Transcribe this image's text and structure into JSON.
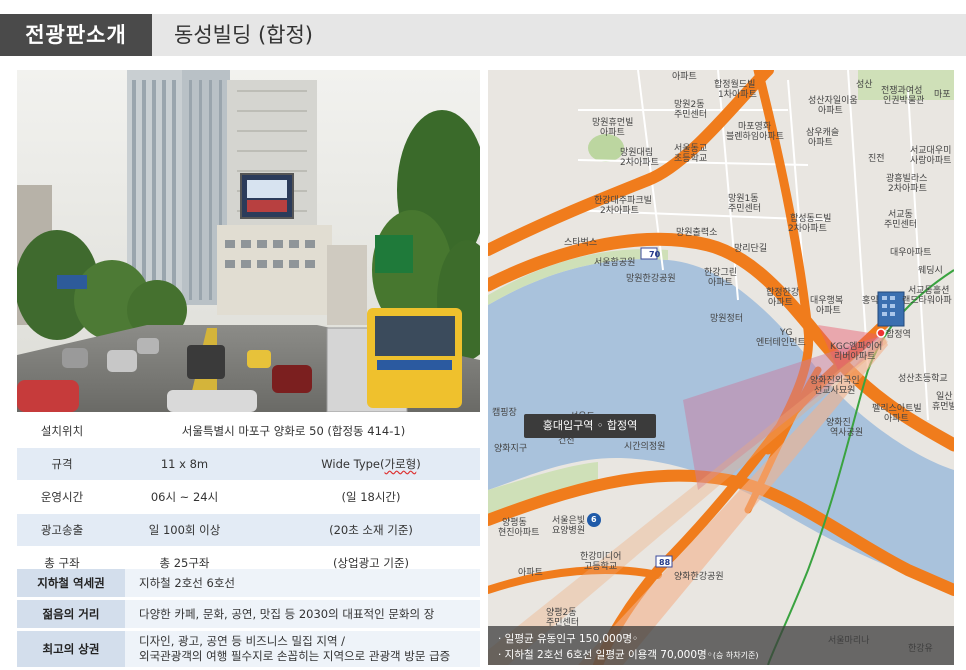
{
  "header": {
    "tag": "전광판소개",
    "title": "동성빌딩 (합정)"
  },
  "specs": [
    {
      "label": "설치위치",
      "value": "서울특별시  마포구 양화로 50 (합정동 414-1)"
    },
    {
      "label": "규격",
      "value": "11 x 8m",
      "extra_pre": "Wide Type(",
      "extra_mark": "가로형",
      "extra_post": ")"
    },
    {
      "label": "운영시간",
      "value": "06시 ~ 24시",
      "extra": "(일 18시간)"
    },
    {
      "label": "광고송출",
      "value": "일 100회 이상",
      "extra": "(20초 소재 기준)"
    },
    {
      "label": "총 구좌",
      "value": "총 25구좌",
      "extra": "(상업광고  기준)"
    }
  ],
  "features": [
    {
      "label": "지하철 역세권",
      "lines": [
        "지하철 2호선 6호선"
      ]
    },
    {
      "label": "젊음의 거리",
      "lines": [
        "다양한 카페, 문화, 공연, 맛집 등 2030의 대표적인 문화의 장"
      ]
    },
    {
      "label": "최고의 상권",
      "lines": [
        "디자인, 광고, 공연 등 비즈니스 밀집 지역 /",
        "외국관광객의  여행 필수지로 손꼽히는 지역으로 관광객 방문 급증"
      ]
    }
  ],
  "map": {
    "station_label": "홍대입구역 ◦ 합정역",
    "foot_line1": "· 일평균 유동인구 150,000명◦",
    "foot_line2_main": "· 지하철 2호선 6호선 일평균 이용객 70,000명◦",
    "foot_line2_small": "(승 하차기준)",
    "route_badges": [
      "70",
      "6",
      "88"
    ],
    "labels": [
      {
        "id": "apt1",
        "text": "아파트"
      },
      {
        "id": "hapjeong1",
        "text": "합정월드빌"
      },
      {
        "id": "hapjeong1b",
        "text": "1차아파트"
      },
      {
        "id": "seongsan",
        "text": "성산"
      },
      {
        "id": "jeonjeol",
        "text": "전쟁과여성"
      },
      {
        "id": "jeonjeolb",
        "text": "인권박물관"
      },
      {
        "id": "mangwon2",
        "text": "망원2동"
      },
      {
        "id": "mangwon2b",
        "text": "주민센터"
      },
      {
        "id": "seongsan2",
        "text": "성산자일이움"
      },
      {
        "id": "seongsan2b",
        "text": "아파트"
      },
      {
        "id": "mapo_r",
        "text": "마포"
      },
      {
        "id": "mangwonapt",
        "text": "망원휴먼빌"
      },
      {
        "id": "mangwonaptb",
        "text": "아파트"
      },
      {
        "id": "mapoyounghwa",
        "text": "마포영화"
      },
      {
        "id": "mapoyounghwab",
        "text": "블렌하임아파트"
      },
      {
        "id": "mangwondaerim",
        "text": "망원대림"
      },
      {
        "id": "mangwondaerimb",
        "text": "2차아파트"
      },
      {
        "id": "seoulelem",
        "text": "서울동교"
      },
      {
        "id": "seoulelemb",
        "text": "초등학교"
      },
      {
        "id": "samwoo",
        "text": "삼우캐슬"
      },
      {
        "id": "samwoob",
        "text": "아파트"
      },
      {
        "id": "jinjeon",
        "text": "진전"
      },
      {
        "id": "seogyo",
        "text": "서교대우미"
      },
      {
        "id": "seogyob",
        "text": "사랑아파트"
      },
      {
        "id": "gwangheung",
        "text": "광흥빌라스"
      },
      {
        "id": "gwangheungb",
        "text": "2차아파트"
      },
      {
        "id": "hangang_river",
        "text": "한강대주파크빌"
      },
      {
        "id": "hangang_riverb",
        "text": "2차아파트"
      },
      {
        "id": "mangwon1",
        "text": "망원1동"
      },
      {
        "id": "mangwon1b",
        "text": "주민센터"
      },
      {
        "id": "hapseong",
        "text": "합성동드빌"
      },
      {
        "id": "hapseongb",
        "text": "2차아파트"
      },
      {
        "id": "seogyo2",
        "text": "서교동"
      },
      {
        "id": "seogyo2b",
        "text": "주민센터"
      },
      {
        "id": "starbucks",
        "text": "스타벅스"
      },
      {
        "id": "mangwon_office",
        "text": "망원출력소"
      },
      {
        "id": "mangridan",
        "text": "망리단길"
      },
      {
        "id": "daewoo",
        "text": "대우아파트"
      },
      {
        "id": "seoulpark",
        "text": "서울함공원"
      },
      {
        "id": "wedding",
        "text": "웨딩시"
      },
      {
        "id": "mangwonpark",
        "text": "망원한강공원"
      },
      {
        "id": "hangang_green",
        "text": "한강그린"
      },
      {
        "id": "hangang_greenb",
        "text": "아파트"
      },
      {
        "id": "hapjeong_apt",
        "text": "합정한강"
      },
      {
        "id": "hapjeong_aptb",
        "text": "아파트"
      },
      {
        "id": "daewoo2",
        "text": "대우행복"
      },
      {
        "id": "daewoo2b",
        "text": "아파트"
      },
      {
        "id": "hongdae",
        "text": "홍익"
      },
      {
        "id": "seogyo3",
        "text": "서교동홀션"
      },
      {
        "id": "seogyo3b",
        "text": "랜드타워아파"
      },
      {
        "id": "mangwonjeong",
        "text": "망원정터"
      },
      {
        "id": "hapjeongstn",
        "text": "합정역"
      },
      {
        "id": "yg",
        "text": "YG"
      },
      {
        "id": "ygb",
        "text": "엔터테인먼트"
      },
      {
        "id": "kgc",
        "text": "KGC엠파이어"
      },
      {
        "id": "kgcb",
        "text": "리버아파트"
      },
      {
        "id": "seongsan_elem",
        "text": "성산초등학교"
      },
      {
        "id": "yanghwajin",
        "text": "양화진외국인"
      },
      {
        "id": "yanghwajinb",
        "text": "선교사묘원"
      },
      {
        "id": "pelis",
        "text": "펠리스아트빌"
      },
      {
        "id": "pelisb",
        "text": "아파트"
      },
      {
        "id": "isan",
        "text": "일산"
      },
      {
        "id": "isanb",
        "text": "휴먼빌"
      },
      {
        "id": "yanghwajin2",
        "text": "양화진"
      },
      {
        "id": "yanghwajin2b",
        "text": "역사공원"
      },
      {
        "id": "keoncheon",
        "text": "건천"
      },
      {
        "id": "sjinban",
        "text": "시간의정원"
      },
      {
        "id": "yangpyeong",
        "text": "양평동"
      },
      {
        "id": "yangpyeongb",
        "text": "현진아파트"
      },
      {
        "id": "seoul_hospital",
        "text": "서울은빛"
      },
      {
        "id": "seoul_hospitalb",
        "text": "요양병원"
      },
      {
        "id": "hangang_media",
        "text": "한강미디어"
      },
      {
        "id": "hangang_mediab",
        "text": "고등학교"
      },
      {
        "id": "yanghwa_park",
        "text": "양화한강공원"
      },
      {
        "id": "apt_bottom",
        "text": "아파트"
      },
      {
        "id": "yangpyeong2",
        "text": "양평2동"
      },
      {
        "id": "yangpyeong2b",
        "text": "주민센터"
      },
      {
        "id": "seoul_marina",
        "text": "서울마리나"
      },
      {
        "id": "hangang_yu",
        "text": "한강유"
      },
      {
        "id": "campground",
        "text": "캠핑장"
      },
      {
        "id": "seonyudo",
        "text": "선유도"
      },
      {
        "id": "yanghwaji",
        "text": "양화지구"
      }
    ]
  },
  "colors": {
    "header_tag_bg": "#4a4a4a",
    "header_bar_bg": "#e6e6e6",
    "table_alt_bg": "#e3ebf5",
    "feature_label_bg": "#d3deec",
    "map_road": "#f07c1c",
    "map_river": "#a9c2dc"
  }
}
